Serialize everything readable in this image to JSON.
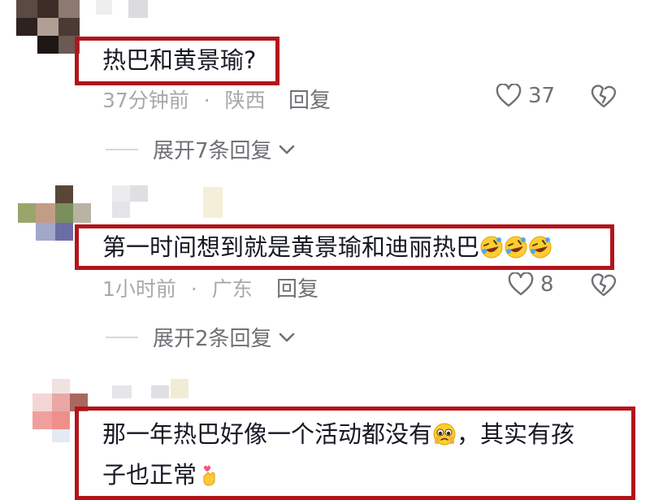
{
  "comments": [
    {
      "text": "热巴和黄景瑜?",
      "time": "37分钟前",
      "location": "陕西",
      "reply_label": "回复",
      "likes": "37",
      "expand_label": "展开7条回复"
    },
    {
      "text": "第一时间想到就是黄景瑜和迪丽热巴",
      "emoji": [
        "rolling-on-floor-laughing",
        "rolling-on-floor-laughing",
        "rolling-on-floor-laughing"
      ],
      "time": "1小时前",
      "location": "广东",
      "reply_label": "回复",
      "likes": "8",
      "expand_label": "展开2条回复"
    },
    {
      "text_line1": "那一年热巴好像一个活动都没有",
      "text_line1_tail": "，其实有孩",
      "text_line2": "子也正常",
      "emoji": [
        "pleading-face",
        "heart-hands"
      ]
    }
  ],
  "colors": {
    "highlight": "#b3141b",
    "meta": "#a8a9ad",
    "secondary": "#6f7075"
  },
  "meta_separator": "·"
}
